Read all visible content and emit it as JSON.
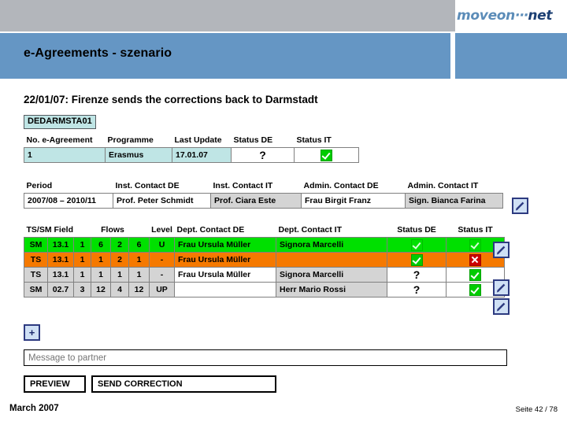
{
  "header": {
    "logo": {
      "part1": "moveon",
      "dots": "···",
      "part2": "net"
    },
    "title": "e-Agreements - szenario"
  },
  "main": {
    "subtitle": "22/01/07: Firenze sends the corrections back to Darmstadt",
    "institution_code": "DEDARMSTA01"
  },
  "agreement_table": {
    "headers": [
      "No. e-Agreement",
      "Programme",
      "Last Update",
      "Status DE",
      "Status IT"
    ],
    "rows": [
      {
        "no": "1",
        "programme": "Erasmus",
        "last_update": "17.01.07",
        "status_de": "?",
        "status_it": "check"
      }
    ]
  },
  "period_table": {
    "headers": [
      "Period",
      "Inst. Contact DE",
      "Inst. Contact IT",
      "Admin. Contact DE",
      "Admin. Contact IT"
    ],
    "rows": [
      {
        "period": "2007/08 – 2010/11",
        "inst_contact_de": "Prof. Peter Schmidt",
        "inst_contact_it": "Prof. Ciara Este",
        "admin_contact_de": "Frau Birgit Franz",
        "admin_contact_it": "Sign. Bianca Farina"
      }
    ],
    "edit_icon": "pencil-icon"
  },
  "flows_table": {
    "headers": {
      "tssm_field": "TS/SM Field",
      "flows": "Flows",
      "level": "Level",
      "dept_contact_de": "Dept. Contact DE",
      "dept_contact_it": "Dept. Contact IT",
      "status_de": "Status DE",
      "status_it": "Status IT"
    },
    "rows": [
      {
        "type": "SM",
        "field": "13.1",
        "f1": "1",
        "f2": "6",
        "f3": "2",
        "f4": "6",
        "level": "U",
        "dept_contact_de": "Frau Ursula Müller",
        "dept_contact_it": "Signora Marcelli",
        "status_de": "check-faded",
        "status_it": "check-faded",
        "highlight": "green",
        "has_edit": true
      },
      {
        "type": "TS",
        "field": "13.1",
        "f1": "1",
        "f2": "1",
        "f3": "2",
        "f4": "1",
        "level": "-",
        "dept_contact_de": "Frau Ursula Müller",
        "dept_contact_it": "",
        "status_de": "check",
        "status_it": "cross",
        "highlight": "orange",
        "has_edit": false
      },
      {
        "type": "TS",
        "field": "13.1",
        "f1": "1",
        "f2": "1",
        "f3": "1",
        "f4": "1",
        "level": "-",
        "dept_contact_de": "Frau Ursula Müller",
        "dept_contact_it": "Signora Marcelli",
        "status_de": "?",
        "status_it": "check",
        "highlight": "none",
        "has_edit": true
      },
      {
        "type": "SM",
        "field": "02.7",
        "f1": "3",
        "f2": "12",
        "f3": "4",
        "f4": "12",
        "level": "UP",
        "dept_contact_de": "",
        "dept_contact_it": "Herr Mario Rossi",
        "status_de": "?",
        "status_it": "check",
        "highlight": "none",
        "has_edit": true
      }
    ]
  },
  "actions": {
    "add_label": "+",
    "message_placeholder": "Message to partner",
    "message_value": "",
    "preview_label": "PREVIEW",
    "send_label": "SEND CORRECTION"
  },
  "footer": {
    "left": "March 2007",
    "right": "Seite 42 / 78"
  },
  "colors": {
    "header_blue": "#6596c4",
    "header_gray": "#b3b6bb",
    "cyan_cell": "#bfe5e5",
    "row_green": "#00e000",
    "row_orange": "#f57900",
    "gray_cell": "#d4d4d4"
  }
}
